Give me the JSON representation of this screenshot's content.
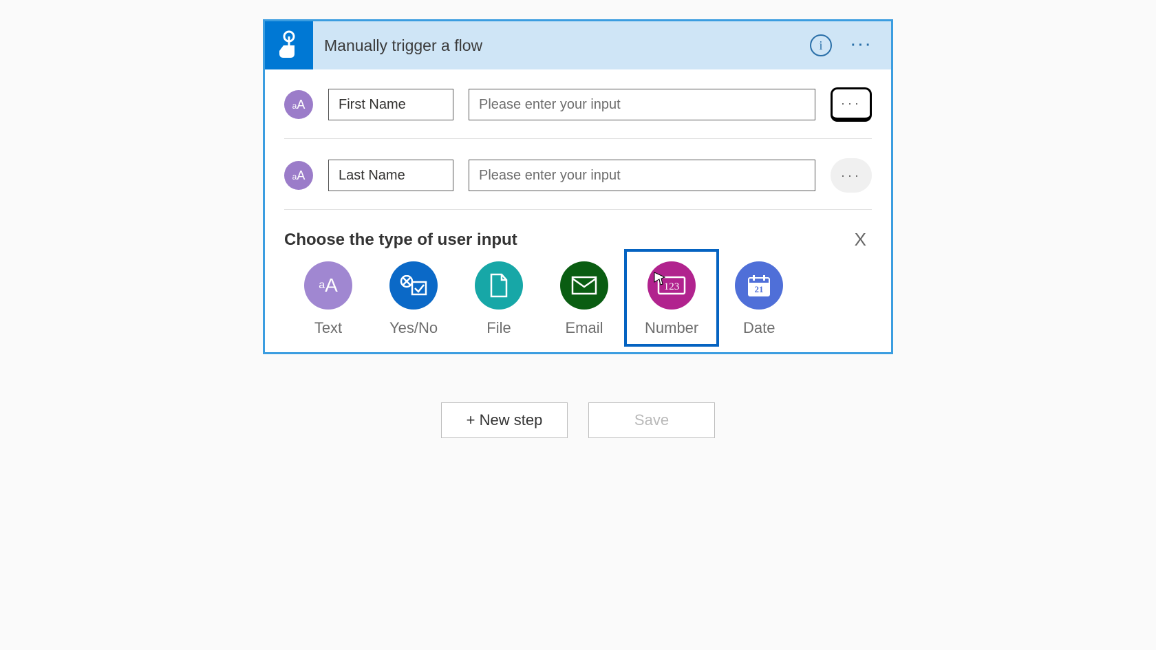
{
  "trigger": {
    "title": "Manually trigger a flow",
    "inputs": [
      {
        "label": "First Name",
        "placeholder": "Please enter your input",
        "menu_focused": true
      },
      {
        "label": "Last Name",
        "placeholder": "Please enter your input",
        "menu_focused": false
      }
    ],
    "chooser": {
      "title": "Choose the type of user input",
      "close": "X",
      "types": [
        {
          "key": "text",
          "label": "Text",
          "selected": false
        },
        {
          "key": "yesno",
          "label": "Yes/No",
          "selected": false
        },
        {
          "key": "file",
          "label": "File",
          "selected": false
        },
        {
          "key": "email",
          "label": "Email",
          "selected": false
        },
        {
          "key": "number",
          "label": "Number",
          "selected": true
        },
        {
          "key": "date",
          "label": "Date",
          "selected": false
        }
      ]
    }
  },
  "footer": {
    "new_step": "+ New step",
    "save": "Save"
  }
}
